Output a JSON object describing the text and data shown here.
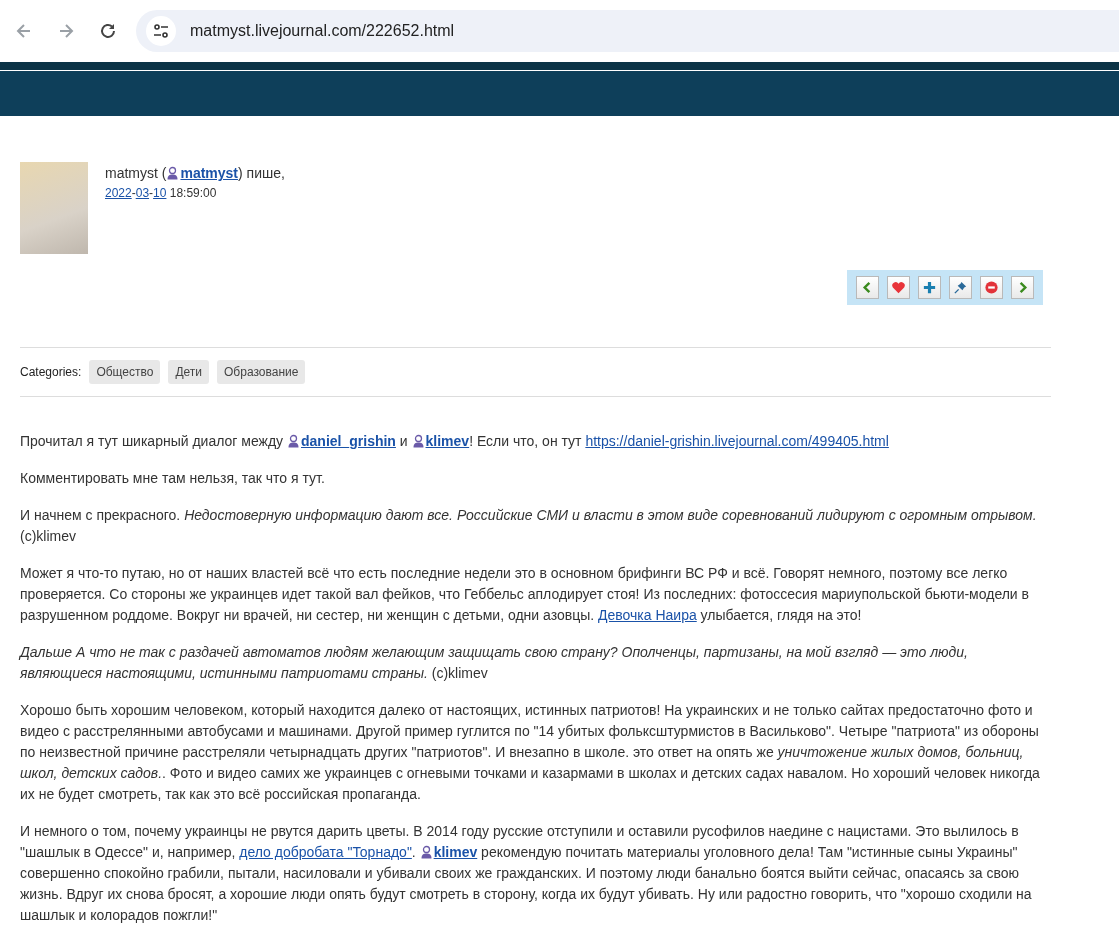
{
  "browser": {
    "url": "matmyst.livejournal.com/222652.html"
  },
  "entry": {
    "author_name": "matmyst (",
    "author_user": "matmyst",
    "author_suffix": ") пише,",
    "date": {
      "year": "2022",
      "month": "03",
      "day": "10",
      "separator": "-",
      "time": "18:59:00"
    }
  },
  "categories": {
    "label": "Categories:",
    "tags": [
      "Общество",
      "Дети",
      "Образование"
    ]
  },
  "paragraphs": [
    [
      {
        "kind": "text",
        "text": "Прочитал я тут шикарный диалог между "
      },
      {
        "kind": "user",
        "text": "daniel_grishin"
      },
      {
        "kind": "text",
        "text": " и "
      },
      {
        "kind": "user",
        "text": "klimev"
      },
      {
        "kind": "text",
        "text": "! Если что, он тут "
      },
      {
        "kind": "link",
        "text": "https://daniel-grishin.livejournal.com/499405.html"
      }
    ],
    [
      {
        "kind": "text",
        "text": "Комментировать мне там нельзя, так что я тут."
      }
    ],
    [
      {
        "kind": "text",
        "text": "И начнем с прекрасного. "
      },
      {
        "kind": "italic",
        "text": "Недостоверную информацию дают все. Российские СМИ и власти в этом виде соревнований лидируют с огромным отрывом."
      },
      {
        "kind": "text",
        "text": " (c)klimev"
      }
    ],
    [
      {
        "kind": "text",
        "text": "Может я что-то путаю, но от наших властей всё что есть последние недели это в основном брифинги ВС РФ и всё. Говорят немного, поэтому все легко проверяется. Со стороны же украинцев идет такой вал фейков, что Геббельс аплодирует стоя! Из последних: фотоссесия мариупольской бьюти-модели в разрушенном роддоме. Вокруг ни врачей, ни сестер, ни женщин с детьми, одни азовцы. "
      },
      {
        "kind": "link",
        "text": "Девочка Наира"
      },
      {
        "kind": "text",
        "text": " улыбается, глядя на это!"
      }
    ],
    [
      {
        "kind": "italic",
        "text": "Дальше А что не так с раздачей автоматов людям желающим защищать свою страну? Ополченцы, партизаны, на мой взгляд — это люди, являющиеся настоящими, истинными патриотами страны."
      },
      {
        "kind": "text",
        "text": " (c)klimev"
      }
    ],
    [
      {
        "kind": "text",
        "text": "Хорошо быть хорошим человеком, который находится далеко от настоящих, истинных патриотов! На украинских и не только сайтах предостаточно фото и видео с расстрелянными автобусами и машинами. Другой пример гуглится по \"14 убитых фолькcштурмистов в Васильково\". Четыре \"патриота\" из обороны по неизвестной причине расстреляли четырнадцать других \"патриотов\". И внезапно в школе. это ответ на опять же "
      },
      {
        "kind": "italic",
        "text": "уничтожение жилых домов, больниц, школ, детских садов."
      },
      {
        "kind": "text",
        "text": ". Фото и видео самих же украинцев с огневыми точками и казармами в школах и детских садах навалом. Но хороший человек никогда их не будет смотреть, так как это всё российская пропаганда."
      }
    ],
    [
      {
        "kind": "text",
        "text": "И немного о том, почему украинцы не рвутся дарить цветы. В 2014 году русские отступили и оставили русофилов наедине с нацистами. Это вылилось в \"шашлык в Одессе\" и, например, "
      },
      {
        "kind": "link",
        "text": "дело добробата \"Торнадо\""
      },
      {
        "kind": "text",
        "text": ". "
      },
      {
        "kind": "user",
        "text": "klimev"
      },
      {
        "kind": "text",
        "text": " рекомендую почитать материалы уголовного дела! Там \"истинные сыны Украины\" совершенно спокойно грабили, пытали, насиловали и убивали своих же гражданских. И поэтому люди банально боятся выйти сейчас, опасаясь за свою жизнь. Вдруг их снова бросят, а хорошие люди опять будут смотреть в сторону, когда их будут убивать. Ну или радостно говорить, что \"хорошо сходили на шашлык и колорадов пожгли!\""
      }
    ]
  ]
}
